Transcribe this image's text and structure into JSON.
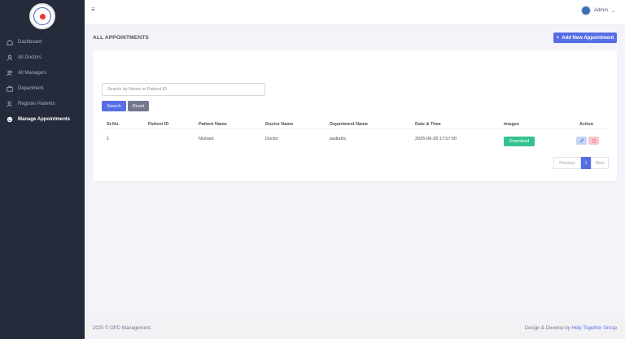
{
  "sidebar": {
    "items": [
      {
        "label": "Dashboard",
        "icon": "home-icon"
      },
      {
        "label": "All Doctors",
        "icon": "user-icon"
      },
      {
        "label": "All Managers",
        "icon": "users-icon"
      },
      {
        "label": "Department",
        "icon": "briefcase-icon"
      },
      {
        "label": "Register Patients",
        "icon": "user-add-icon"
      },
      {
        "label": "Manage Appointments",
        "icon": "smile-icon"
      }
    ],
    "active_index": 5
  },
  "topbar": {
    "menu_icon": "≡",
    "user_name": "Admin",
    "chevron": "⌄"
  },
  "page": {
    "title": "ALL APPOINTMENTS",
    "add_button": "Add New Appointment",
    "add_icon": "+"
  },
  "search": {
    "placeholder": "Search by Name or Patient ID",
    "search_button": "Search",
    "reset_button": "Reset"
  },
  "table": {
    "columns": [
      "Sr.No.",
      "Patient ID",
      "Patient Name",
      "Doctor Name",
      "Department Name",
      "Date & Time",
      "Images",
      "Action"
    ],
    "rows": [
      {
        "sr": "1",
        "patient_id": "",
        "patient_name": "Nishant",
        "doctor_name": "Doctor",
        "department": "padiatric",
        "datetime": "2025-06-28 17:57:00",
        "download_label": "Download"
      }
    ]
  },
  "pagination": {
    "prev": "Previous",
    "current": "1",
    "next": "Next"
  },
  "footer": {
    "copyright": "2025 © OPD Management.",
    "credit_prefix": "Design & Develop by ",
    "credit_link": "Help Together Group"
  },
  "colors": {
    "sidebar": "#252b3b",
    "primary": "#556ee6",
    "success": "#34c38f",
    "secondary": "#74788d"
  }
}
